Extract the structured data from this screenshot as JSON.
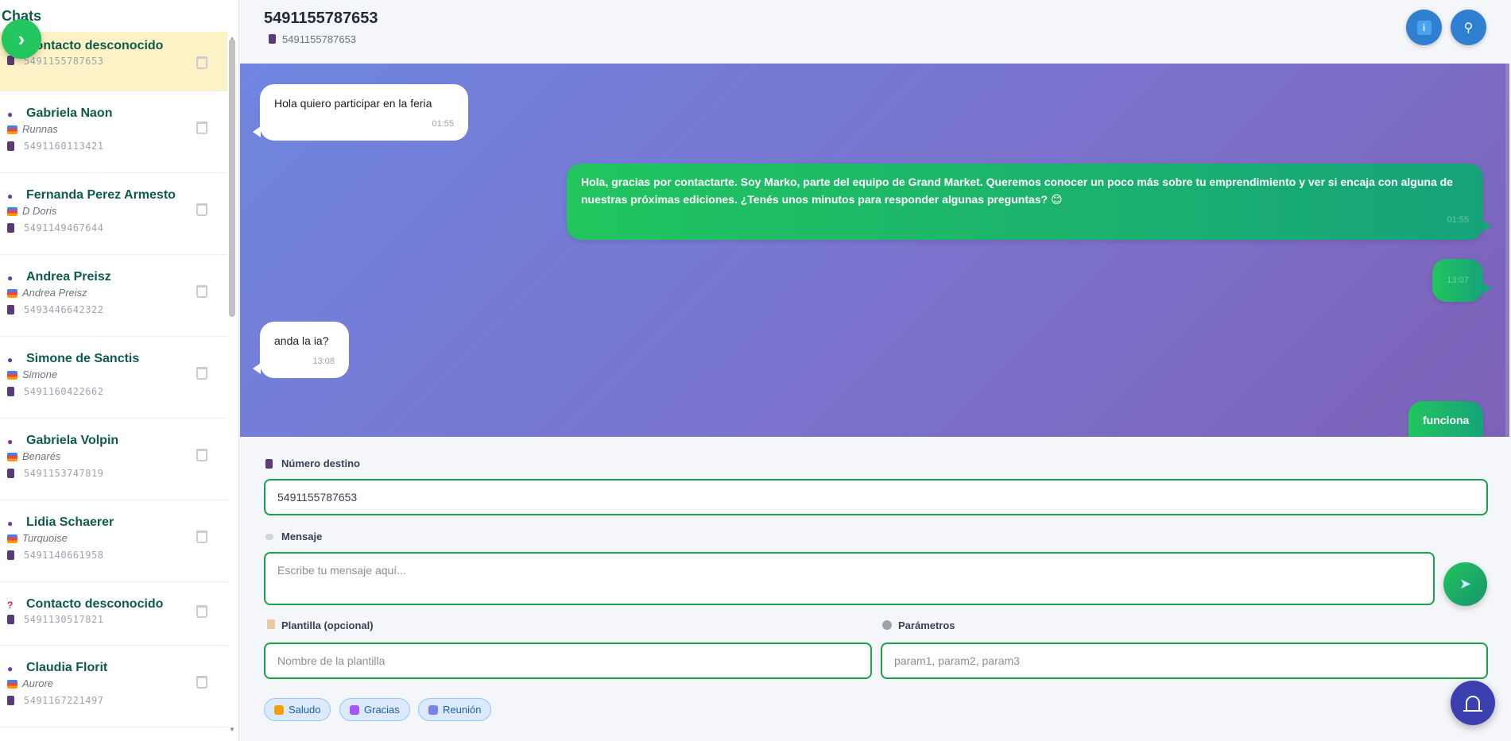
{
  "sidebar": {
    "title": "Chats",
    "chats": [
      {
        "name": "Contacto desconocido",
        "alias": "",
        "phone": "5491155787653",
        "type": "unknown",
        "active": true
      },
      {
        "name": "Gabriela Naon",
        "alias": "Runnas",
        "phone": "5491160113421",
        "type": "person"
      },
      {
        "name": "Fernanda Perez Armesto",
        "alias": "D Doris",
        "phone": "5491149467644",
        "type": "person"
      },
      {
        "name": "Andrea Preisz",
        "alias": "Andrea Preisz",
        "phone": "5493446642322",
        "type": "person"
      },
      {
        "name": "Simone de Sanctis",
        "alias": "Simone",
        "phone": "5491160422662",
        "type": "person"
      },
      {
        "name": "Gabriela Volpin",
        "alias": "Benarés",
        "phone": "5491153747819",
        "type": "person"
      },
      {
        "name": "Lidia Schaerer",
        "alias": "Turquoise",
        "phone": "5491140661958",
        "type": "person"
      },
      {
        "name": "Contacto desconocido",
        "alias": "",
        "phone": "5491130517821",
        "type": "unknown"
      },
      {
        "name": "Claudia Florit",
        "alias": "Aurore",
        "phone": "5491167221497",
        "type": "person"
      }
    ]
  },
  "header": {
    "title": "5491155787653",
    "subtitle": "5491155787653",
    "info_icon": "info-icon",
    "search_icon": "search-icon"
  },
  "messages": [
    {
      "direction": "in",
      "text": "Hola quiero participar en la feria",
      "time": "01:55"
    },
    {
      "direction": "out",
      "text": "Hola, gracias por contactarte. Soy Marko, parte del equipo de Grand Market. Queremos conocer un poco más sobre tu emprendimiento y ver si encaja con alguna de nuestras próximas ediciones. ¿Tenés unos minutos para responder algunas preguntas? 😊",
      "time": "01:55"
    },
    {
      "direction": "out",
      "text": "",
      "time": "13:07"
    },
    {
      "direction": "in",
      "text": "anda la ia?",
      "time": "13:08"
    },
    {
      "direction": "out",
      "text": "funciona",
      "time": ""
    }
  ],
  "composer": {
    "destination_label": "Número destino",
    "destination_value": "5491155787653",
    "message_label": "Mensaje",
    "message_placeholder": "Escribe tu mensaje aquí...",
    "template_label": "Plantilla (opcional)",
    "template_placeholder": "Nombre de la plantilla",
    "params_label": "Parámetros",
    "params_placeholder": "param1, param2, param3",
    "quick_replies": [
      "Saludo",
      "Gracias",
      "Reunión"
    ]
  },
  "colors": {
    "accent": "#16a34a",
    "chat_name": "#0d5b4a",
    "header_button": "#2f80d1",
    "bell_button": "#3b3fb0",
    "active_chat": "#fef3c7"
  }
}
